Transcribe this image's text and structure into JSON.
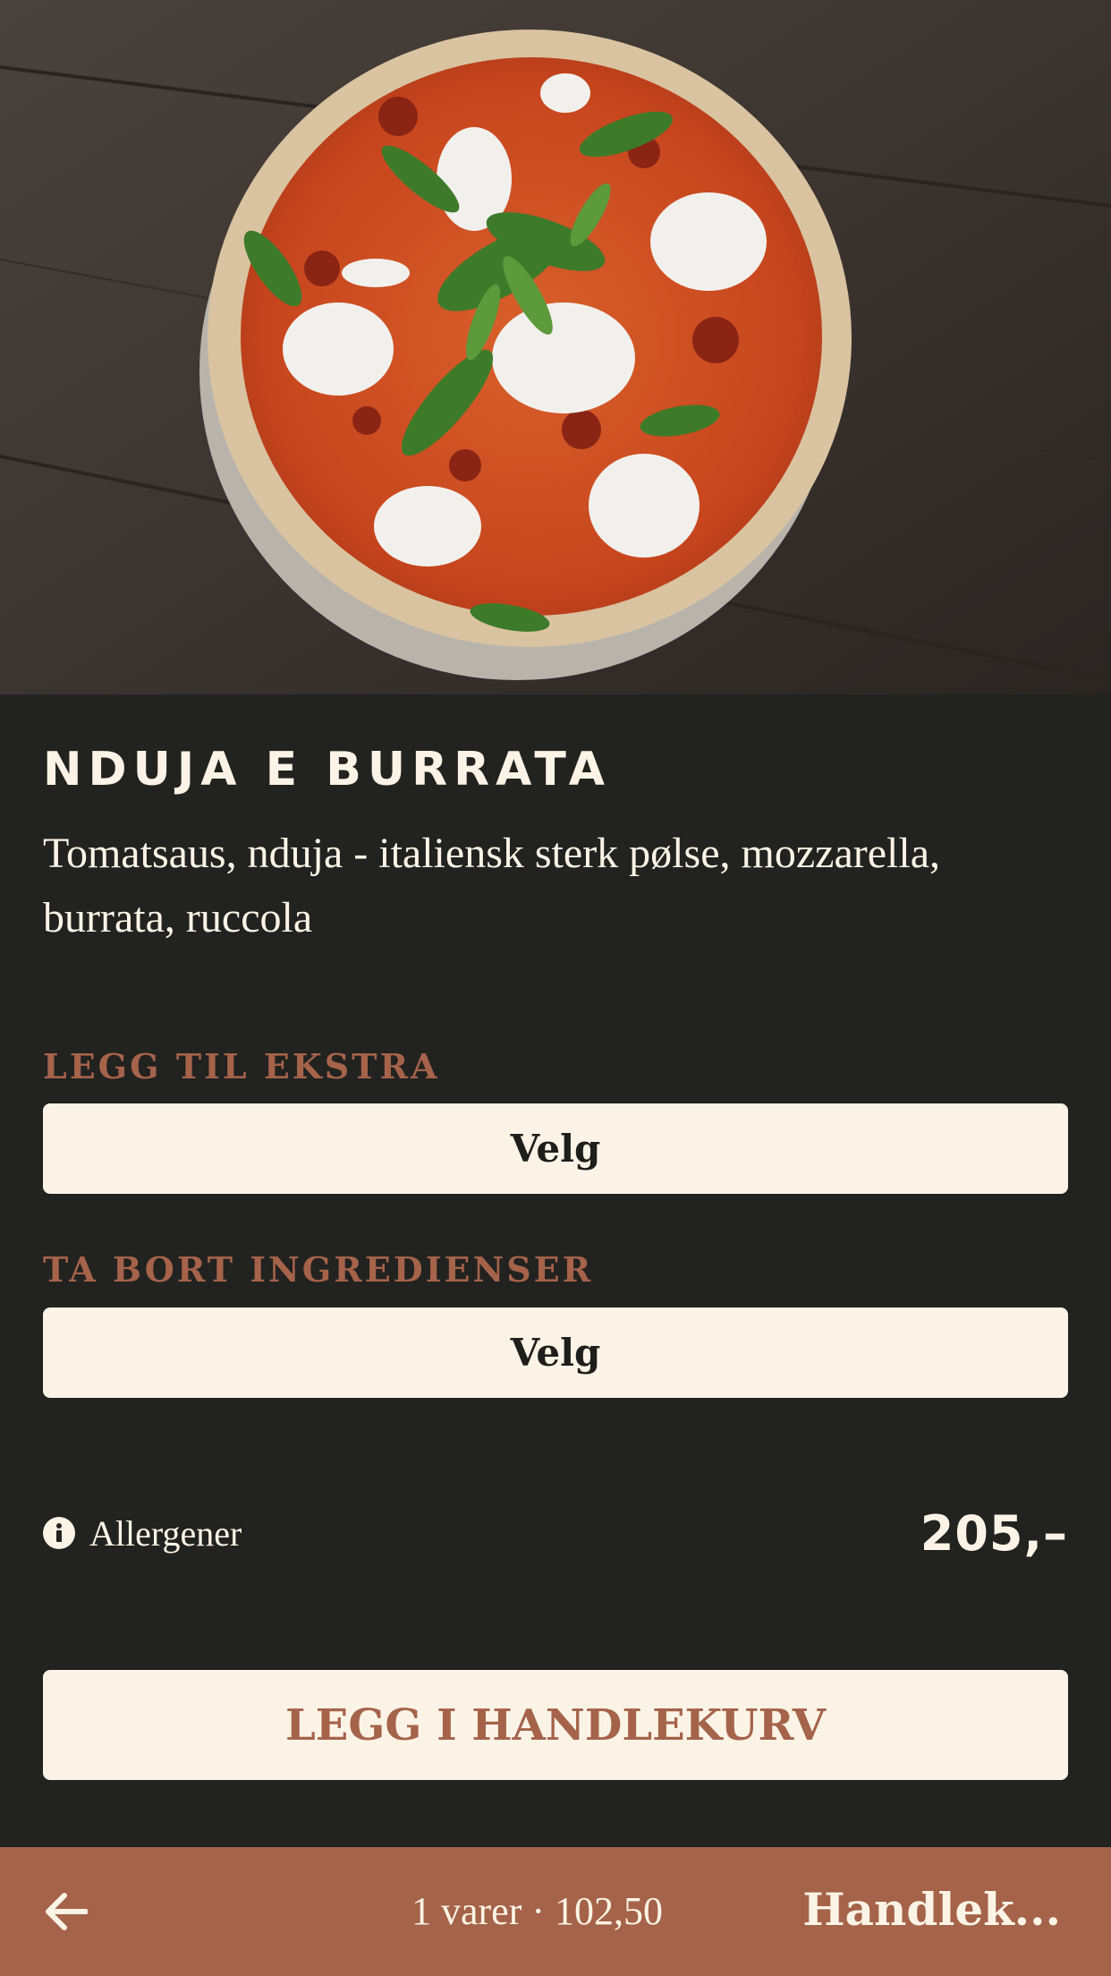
{
  "product": {
    "name": "NDUJA E BURRATA",
    "description": "Tomatsaus, nduja - italiensk sterk pølse, mozzarella, burrata, ruccola",
    "price": "205,–",
    "image_icon": "pizza-photo"
  },
  "options": {
    "extra": {
      "label": "LEGG TIL EKSTRA",
      "button": "Velg"
    },
    "remove": {
      "label": "TA BORT INGREDIENSER",
      "button": "Velg"
    }
  },
  "allergens": {
    "label": "Allergener",
    "icon": "info-icon"
  },
  "actions": {
    "add_to_cart": "LEGG I HANDLEKURV"
  },
  "bottom_bar": {
    "back_icon": "arrow-left-icon",
    "summary": "1 varer · 102,50",
    "cart_label": "Handlek..."
  },
  "colors": {
    "background": "#222220",
    "cream": "#fbf4e6",
    "accent": "#a5634a"
  }
}
